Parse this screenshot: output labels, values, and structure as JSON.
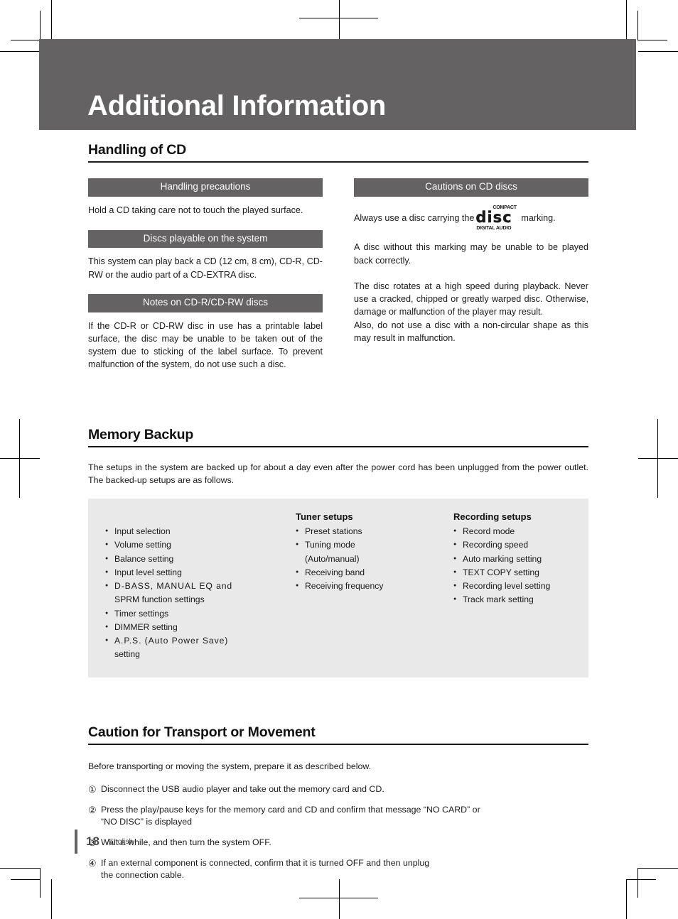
{
  "chapter": {
    "title": "Additional Information"
  },
  "sections": {
    "handling": {
      "title": "Handling of CD",
      "left": {
        "sub1": "Handling precautions",
        "body1": "Hold a CD taking care not to touch the played surface.",
        "sub2": "Discs playable on the system",
        "body2": "This system can play back a CD (12 cm, 8 cm), CD-R, CD-RW or the audio part of a CD-EXTRA disc.",
        "sub3": "Notes on CD-R/CD-RW discs",
        "body3": "If the CD-R or CD-RW disc in use has a printable label surface, the disc may be unable to be taken out of the system due to sticking of the label surface. To prevent malfunction of the system, do not use such a disc."
      },
      "right": {
        "sub1": "Cautions on CD discs",
        "marking_before": "Always use a disc carrying the",
        "marking_after": "marking.",
        "logo": {
          "top": "COMPACT",
          "mid": "disc",
          "bottom": "DIGITAL AUDIO"
        },
        "body2": "A disc without this marking may be unable to be played back correctly.",
        "body3": "The disc rotates at a high speed during playback. Never use a cracked, chipped or greatly warped disc. Otherwise, damage or malfunction of the player may result.",
        "body4": "Also, do not use a disc with a non-circular shape as this may result in malfunction."
      }
    },
    "memory": {
      "title": "Memory Backup",
      "intro": "The setups in the system are backed up for about a day even after the power cord has been unplugged from the power outlet. The backed-up setups are as follows.",
      "columns": [
        {
          "heading": "",
          "items": [
            "Input selection",
            "Volume setting",
            "Balance setting",
            "Input level setting",
            "D-BASS, MANUAL EQ and",
            "Timer settings",
            "DIMMER setting",
            "A.P.S. (Auto Power Save)"
          ],
          "item5_cont": "SPRM function settings",
          "item8_cont": "setting"
        },
        {
          "heading": "Tuner setups",
          "items": [
            "Preset stations",
            "Tuning mode",
            "Receiving band",
            "Receiving frequency"
          ],
          "item2_cont": "(Auto/manual)"
        },
        {
          "heading": "Recording setups",
          "items": [
            "Record mode",
            "Recording speed",
            "Auto marking setting",
            "TEXT COPY setting",
            "Recording level setting",
            "Track mark setting"
          ]
        }
      ]
    },
    "transport": {
      "title": "Caution for Transport or Movement",
      "intro": "Before transporting or moving the system, prepare it as described below.",
      "steps": [
        {
          "num": "①",
          "line1": "Disconnect the USB audio player and take out the memory card and CD.",
          "line2": ""
        },
        {
          "num": "②",
          "line1": "Press the play/pause keys for the memory card and CD and confirm that message “NO CARD” or",
          "line2": "“NO DISC” is displayed"
        },
        {
          "num": "③",
          "line1": "Wait a while, and then turn the system OFF.",
          "line2": ""
        },
        {
          "num": "④",
          "line1": "If an external component is connected, confirm that it is turned OFF and then unplug",
          "line2": "the connection cable."
        }
      ]
    }
  },
  "footer": {
    "page_number": "18",
    "language": "English"
  },
  "colors": {
    "banner": "#656263",
    "subhead": "#656263",
    "backup_box": "#e9e9e9",
    "text": "#1a1a1a"
  }
}
